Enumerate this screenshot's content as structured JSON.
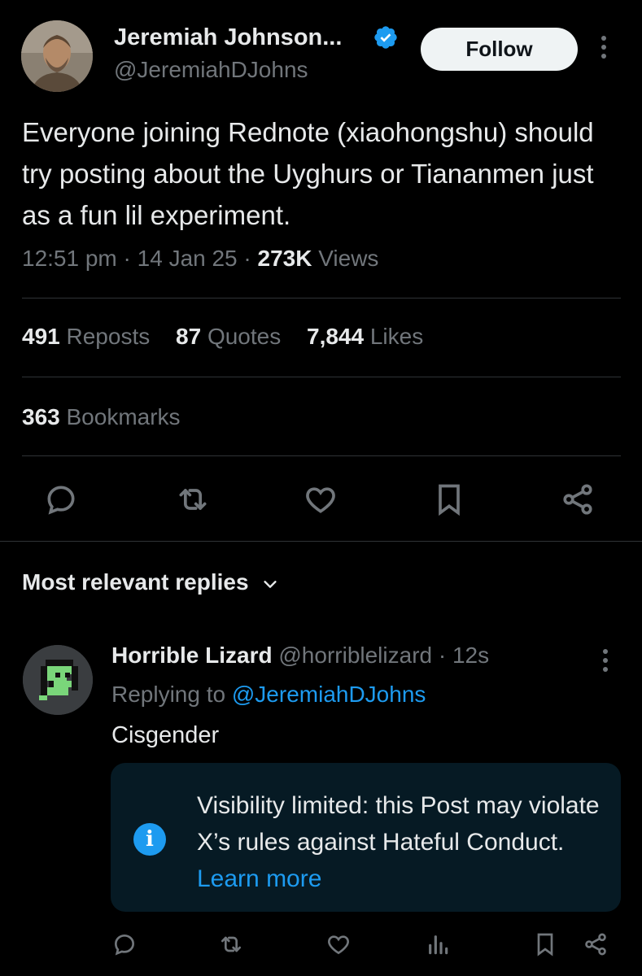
{
  "post": {
    "author_name": "Jeremiah Johnson...",
    "author_handle": "@JeremiahDJohns",
    "follow_label": "Follow",
    "text": "Everyone joining Rednote (xiaohongshu) should try posting about the Uyghurs or Tiananmen just as a fun lil experiment.",
    "time": "12:51 pm",
    "date": "14 Jan 25",
    "views_count": "273K",
    "views_label": "Views",
    "reposts_count": "491",
    "reposts_label": "Reposts",
    "quotes_count": "87",
    "quotes_label": "Quotes",
    "likes_count": "7,844",
    "likes_label": "Likes",
    "bookmarks_count": "363",
    "bookmarks_label": "Bookmarks",
    "actions": [
      "reply-icon",
      "repost-icon",
      "like-icon",
      "bookmark-icon",
      "share-icon"
    ]
  },
  "replies_header": "Most relevant replies",
  "reply": {
    "author_name": "Horrible Lizard",
    "author_handle": "@horriblelizard",
    "separator": "·",
    "time": "12s",
    "replying_prefix": "Replying to",
    "replying_handle": "@JeremiahDJohns",
    "text": "Cisgender",
    "notice_text": "Visibility limited: this Post may violate X’s rules against Hateful Conduct.",
    "notice_link": "Learn more",
    "actions": [
      "reply-icon",
      "repost-icon",
      "like-icon",
      "views-icon",
      "bookmark-icon",
      "share-icon"
    ]
  },
  "colors": {
    "background": "#000000",
    "text": "#e7e9ea",
    "muted": "#71767b",
    "accent": "#1d9bf0",
    "divider": "#2f3336",
    "notice_bg": "#061a24"
  }
}
